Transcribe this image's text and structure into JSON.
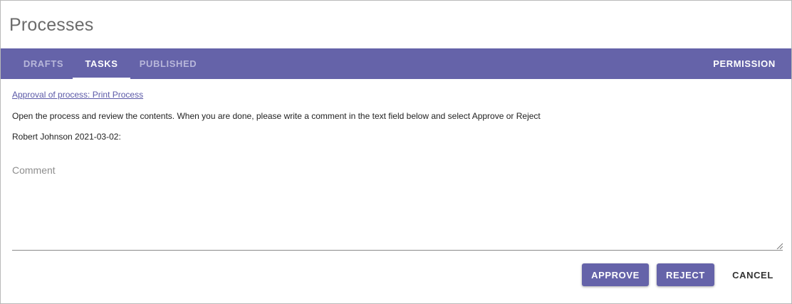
{
  "page": {
    "title": "Processes"
  },
  "tabs": {
    "drafts": "DRAFTS",
    "tasks": "TASKS",
    "published": "PUBLISHED",
    "permission": "PERMISSION",
    "active": "tasks"
  },
  "task": {
    "link_text": "Approval of process: Print Process",
    "description": "Open the process and review the contents. When you are done, please write a comment in the text field below and select Approve or Reject",
    "author_line": "Robert Johnson 2021-03-02:"
  },
  "comment": {
    "placeholder": "Comment",
    "value": ""
  },
  "actions": {
    "approve": "APPROVE",
    "reject": "REJECT",
    "cancel": "CANCEL"
  },
  "colors": {
    "accent": "#6563a9",
    "tab_inactive_text": "#b8b7da",
    "link": "#5b59a7"
  }
}
